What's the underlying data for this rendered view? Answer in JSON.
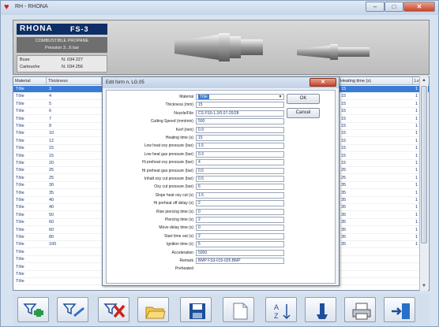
{
  "window": {
    "title": "RH - RHONA"
  },
  "banner": {
    "brand": "RHONA",
    "model": "FS-3",
    "product_line1": "COMBUSTIBLE PROPANE",
    "product_line2": "Pression 3...6 bar",
    "ref_rows": [
      {
        "label": "Buse",
        "value": "N. 034 227"
      },
      {
        "label": "Cartouche",
        "value": "N. 034 256"
      }
    ]
  },
  "grid": {
    "headers": [
      "Material",
      "Thickness",
      "Heating time (s)",
      "Lv"
    ],
    "left_col1": [
      "Tôle",
      "Tôle",
      "Tôle",
      "Tôle",
      "Tôle",
      "Tôle",
      "Tôle",
      "Tôle",
      "Tôle",
      "Tôle",
      "Tôle",
      "Tôle",
      "Tôle",
      "Tôle",
      "Tôle",
      "Tôle",
      "Tôle",
      "Tôle",
      "Tôle",
      "Tôle",
      "Tôle",
      "Tôle",
      "Tôle",
      "Tôle",
      "Tôle",
      "Tôle",
      "Tôle"
    ],
    "left_col2": [
      "3",
      "4",
      "5",
      "6",
      "7",
      "8",
      "10",
      "12",
      "15",
      "15",
      "20",
      "25",
      "25",
      "30",
      "35",
      "40",
      "40",
      "50",
      "60",
      "60",
      "80",
      "100",
      "",
      "",
      "",
      "",
      ""
    ],
    "right_col1": [
      "15",
      "15",
      "15",
      "15",
      "15",
      "15",
      "15",
      "15",
      "15",
      "15",
      "15",
      "25",
      "25",
      "35",
      "35",
      "35",
      "35",
      "35",
      "35",
      "35",
      "35",
      "35",
      "",
      "",
      "",
      "",
      ""
    ],
    "right_col2": [
      "1",
      "1",
      "1",
      "1",
      "1",
      "1",
      "1",
      "1",
      "1",
      "1",
      "1",
      "1",
      "1",
      "1",
      "1",
      "1",
      "1",
      "1",
      "1",
      "1",
      "1",
      "1",
      "",
      "",
      "",
      "",
      ""
    ]
  },
  "dialog": {
    "title": "Edit form n. LG.05",
    "ok_label": "OK",
    "cancel_label": "Cancel",
    "fields": [
      {
        "label": "Material",
        "value": "Tôle"
      },
      {
        "label": "Thickness (mm)",
        "value": "15"
      },
      {
        "label": "Nozzle/File",
        "value": "CS FS0-1.2/0.07-20/28"
      },
      {
        "label": "Cutting Speed (mm/min)",
        "value": "500"
      },
      {
        "label": "Kerf (mm)",
        "value": "0.9"
      },
      {
        "label": "Heating time (s)",
        "value": "15"
      },
      {
        "label": "Low heat oxy pressure (bar)",
        "value": "1.5"
      },
      {
        "label": "Low heat gas pressure (bar)",
        "value": "0.3"
      },
      {
        "label": "Hi preheat oxy pressure (bar)",
        "value": "4"
      },
      {
        "label": "Hi preheat gas pressure (bar)",
        "value": "0.5"
      },
      {
        "label": "Inhalt oxy cut pressure (bar)",
        "value": "0.5"
      },
      {
        "label": "Oxy cut pressure (bar)",
        "value": "6"
      },
      {
        "label": "Slope heat oxy cut (s)",
        "value": "1.5"
      },
      {
        "label": "Hi preheat off delay (s)",
        "value": "2"
      },
      {
        "label": "Rise piercing time (s)",
        "value": "0"
      },
      {
        "label": "Piercing time (s)",
        "value": "2"
      },
      {
        "label": "Move delay time (s)",
        "value": "0"
      },
      {
        "label": "Start time out (s)",
        "value": "2"
      },
      {
        "label": "Ignition time (s)",
        "value": "5"
      },
      {
        "label": "Acceleration",
        "value": "5000"
      },
      {
        "label": "Remark",
        "value": "BMP FS3-015-025.BMP"
      },
      {
        "label": "Preheated",
        "value": ""
      }
    ]
  },
  "toolbar": {
    "buttons": [
      "filter-add-icon",
      "filter-edit-icon",
      "filter-remove-icon",
      "folder-open-icon",
      "save-icon",
      "new-document-icon",
      "sort-az-icon",
      "torch-icon",
      "print-icon",
      "exit-icon"
    ]
  },
  "colors": {
    "selection": "#3a7bd5",
    "banner_brand": "#0f2e66",
    "close_red": "#c7432a",
    "cell_text": "#1f3a78"
  }
}
